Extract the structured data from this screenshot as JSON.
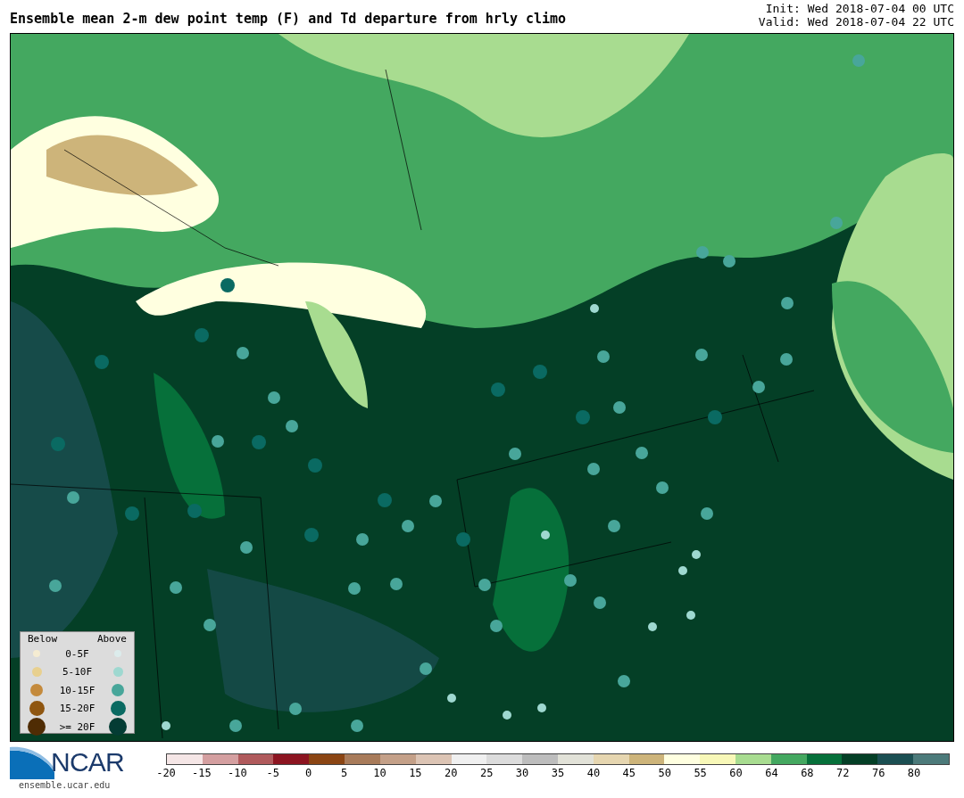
{
  "title": "Ensemble mean 2-m dew point temp (F) and Td departure from hrly climo",
  "init": "Init: Wed 2018-07-04 00 UTC",
  "valid": "Valid: Wed 2018-07-04 22 UTC",
  "legend": {
    "below_heading": "Below",
    "above_heading": "Above",
    "entries": [
      {
        "label": "0-5F",
        "markers": [
          {
            "color": "#f5ecd2"
          },
          {
            "color": "#dcecec"
          }
        ]
      },
      {
        "label": "5-10F",
        "markers": [
          {
            "color": "#e8d08f"
          },
          {
            "color": "#9ed8d0"
          }
        ]
      },
      {
        "label": "10-15F",
        "markers": [
          {
            "color": "#c48a3c"
          },
          {
            "color": "#48a69a"
          }
        ]
      },
      {
        "label": "15-20F",
        "markers": [
          {
            "color": "#8f5610"
          },
          {
            "color": "#0a6a62"
          }
        ]
      },
      {
        "label": ">= 20F",
        "markers": [
          {
            "color": "#4f2c04"
          },
          {
            "color": "#043c34"
          }
        ]
      }
    ]
  },
  "logo": {
    "text": "NCAR",
    "url": "ensemble.ucar.edu"
  },
  "colorbar": {
    "segments": [
      {
        "color": "#f5e6e6"
      },
      {
        "color": "#d49fa0"
      },
      {
        "color": "#b05a5c"
      },
      {
        "color": "#8c1420"
      },
      {
        "color": "#8b4513"
      },
      {
        "color": "#a87b5a"
      },
      {
        "color": "#c4a088"
      },
      {
        "color": "#dcc4b4"
      },
      {
        "color": "#f0f0f0"
      },
      {
        "color": "#dcdcdc"
      },
      {
        "color": "#bdbdbd"
      },
      {
        "color": "#e2e2d8"
      },
      {
        "color": "#e6d6b0"
      },
      {
        "color": "#cdb47a"
      },
      {
        "color": "#ffffe0"
      },
      {
        "color": "#f8f8b8"
      },
      {
        "color": "#a8dc90"
      },
      {
        "color": "#44a860"
      },
      {
        "color": "#06703a"
      },
      {
        "color": "#043f26"
      },
      {
        "color": "#1b4f52"
      },
      {
        "color": "#4c7a7a"
      }
    ],
    "ticks": [
      "-20",
      "-15",
      "-10",
      "-5",
      "0",
      "5",
      "10",
      "15",
      "20",
      "25",
      "30",
      "35",
      "40",
      "45",
      "50",
      "55",
      "60",
      "64",
      "68",
      "72",
      "76",
      "80"
    ]
  }
}
